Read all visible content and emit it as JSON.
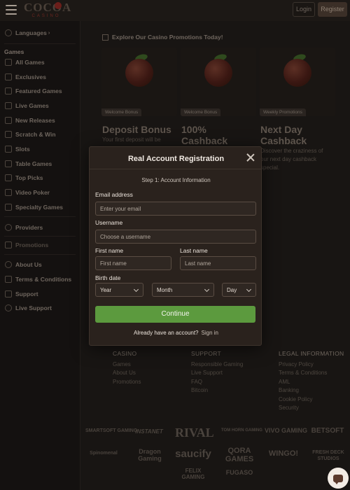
{
  "header": {
    "logo_main": "COCOA",
    "logo_sub": "CASINO",
    "login_label": "Login",
    "register_label": "Register"
  },
  "sidebar": {
    "languages_label": "Languages",
    "section_games": "Games",
    "items": [
      {
        "label": "All Games",
        "icon": "horseshoe-icon"
      },
      {
        "label": "Exclusives",
        "icon": "diamond-icon"
      },
      {
        "label": "Featured Games",
        "icon": "star-icon"
      },
      {
        "label": "Live Games",
        "icon": "cards-icon"
      },
      {
        "label": "New Releases",
        "icon": "sparkle-icon"
      },
      {
        "label": "Scratch & Win",
        "icon": "ticket-icon"
      },
      {
        "label": "Slots",
        "icon": "slot-icon"
      },
      {
        "label": "Table Games",
        "icon": "table-icon"
      },
      {
        "label": "Top Picks",
        "icon": "trophy-icon"
      },
      {
        "label": "Video Poker",
        "icon": "poker-icon"
      },
      {
        "label": "Specialty Games",
        "icon": "dice-icon"
      }
    ],
    "providers_label": "Providers",
    "promotions_label": "Promotions",
    "bottom_items": [
      {
        "label": "About Us",
        "icon": "info-icon"
      },
      {
        "label": "Terms & Conditions",
        "icon": "document-icon"
      },
      {
        "label": "Support",
        "icon": "support-icon"
      },
      {
        "label": "Live Support",
        "icon": "chat-icon"
      }
    ]
  },
  "promotions": {
    "heading": "Explore Our Casino Promotions Today!",
    "cards": [
      {
        "badge": "Welcome Bonus",
        "title": "Deposit Bonus",
        "desc": "Your first deposit will be"
      },
      {
        "badge": "Welcome Bonus",
        "title": "100% Cashback",
        "desc": ""
      },
      {
        "badge": "Weekly Promotions",
        "title": "Next Day Cashback",
        "desc": "Discover the craziness of our next day cashback special."
      }
    ]
  },
  "modal": {
    "title": "Real Account Registration",
    "step": "Step 1: Account Information",
    "email_label": "Email address",
    "email_placeholder": "Enter your email",
    "username_label": "Username",
    "username_placeholder": "Choose a username",
    "first_name_label": "First name",
    "first_name_placeholder": "First name",
    "last_name_label": "Last name",
    "last_name_placeholder": "Last name",
    "birth_label": "Birth date",
    "year": "Year",
    "month": "Month",
    "day": "Day",
    "continue_label": "Continue",
    "have_account": "Already have an account?",
    "sign_in": "Sign in"
  },
  "footer": {
    "casino_title": "CASINO",
    "casino_links": [
      "Games",
      "About Us",
      "Promotions"
    ],
    "support_title": "SUPPORT",
    "support_links": [
      "Responsible Gaming",
      "Live Support",
      "FAQ",
      "Bitcoin"
    ],
    "legal_title": "LEGAL INFORMATION",
    "legal_links": [
      "Privacy Policy",
      "Terms & Conditions",
      "AML",
      "Banking",
      "Cookie Policy",
      "Security"
    ],
    "providers": [
      "SMARTSOFT GAMING",
      "INSTANET",
      "RIVAL",
      "TOM HORN GAMING",
      "VIVO GAMING",
      "BETSOFT",
      "Spinomenal",
      "Dragon Gaming",
      "saucify",
      "QORA GAMES",
      "WINGO!",
      "FRESH DECK STUDIOS",
      "FELIX GAMING",
      "FUGASO"
    ]
  }
}
